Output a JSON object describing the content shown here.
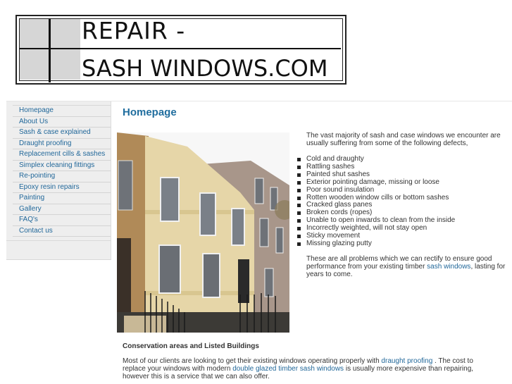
{
  "logo": {
    "line1": "REPAIR -",
    "line2": "SASH WINDOWS.COM"
  },
  "sidebar": {
    "items": [
      {
        "label": "Homepage"
      },
      {
        "label": "About Us"
      },
      {
        "label": "Sash & case explained"
      },
      {
        "label": "Draught proofing"
      },
      {
        "label": "Replacement cills & sashes"
      },
      {
        "label": "Simplex cleaning fittings"
      },
      {
        "label": "Re-pointing"
      },
      {
        "label": "Epoxy resin repairs"
      },
      {
        "label": "Painting"
      },
      {
        "label": "Gallery"
      },
      {
        "label": "FAQ's"
      },
      {
        "label": "Contact us"
      }
    ]
  },
  "main": {
    "title": "Homepage",
    "photo_alt": "Georgian terrace building with sash windows",
    "intro": "The vast majority of sash and case windows we encounter are usually suffering from some of the following defects,",
    "defects": [
      "Cold and draughty",
      "Rattling sashes",
      "Painted shut sashes",
      "Exterior pointing damage, missing or loose",
      "Poor sound insulation",
      "Rotten wooden window cills or bottom sashes",
      "Cracked glass panes",
      "Broken cords (ropes)",
      "Unable to open inwards to clean from the inside",
      "Incorrectly weighted, will not stay open",
      "Sticky movement",
      "Missing glazing putty"
    ],
    "outro_pre": "These are all problems which we can rectify to ensure good performance from your existing timber ",
    "outro_link": "sash windows",
    "outro_post": ", lasting for years to come.",
    "conservation_heading": "Conservation areas and Listed Buildings",
    "cons_text_1": "Most of our clients are looking to get their existing windows operating properly with ",
    "cons_link_1": "draught proofing",
    "cons_text_2": " . The cost to replace your windows with modern ",
    "cons_link_2": "double glazed timber sash windows",
    "cons_text_3": " is usually more expensive than repairing, however this is a service that we can also offer."
  },
  "colors": {
    "link": "#22689a",
    "title": "#1f6d9e",
    "sidebar_bg": "#eeeeee"
  }
}
